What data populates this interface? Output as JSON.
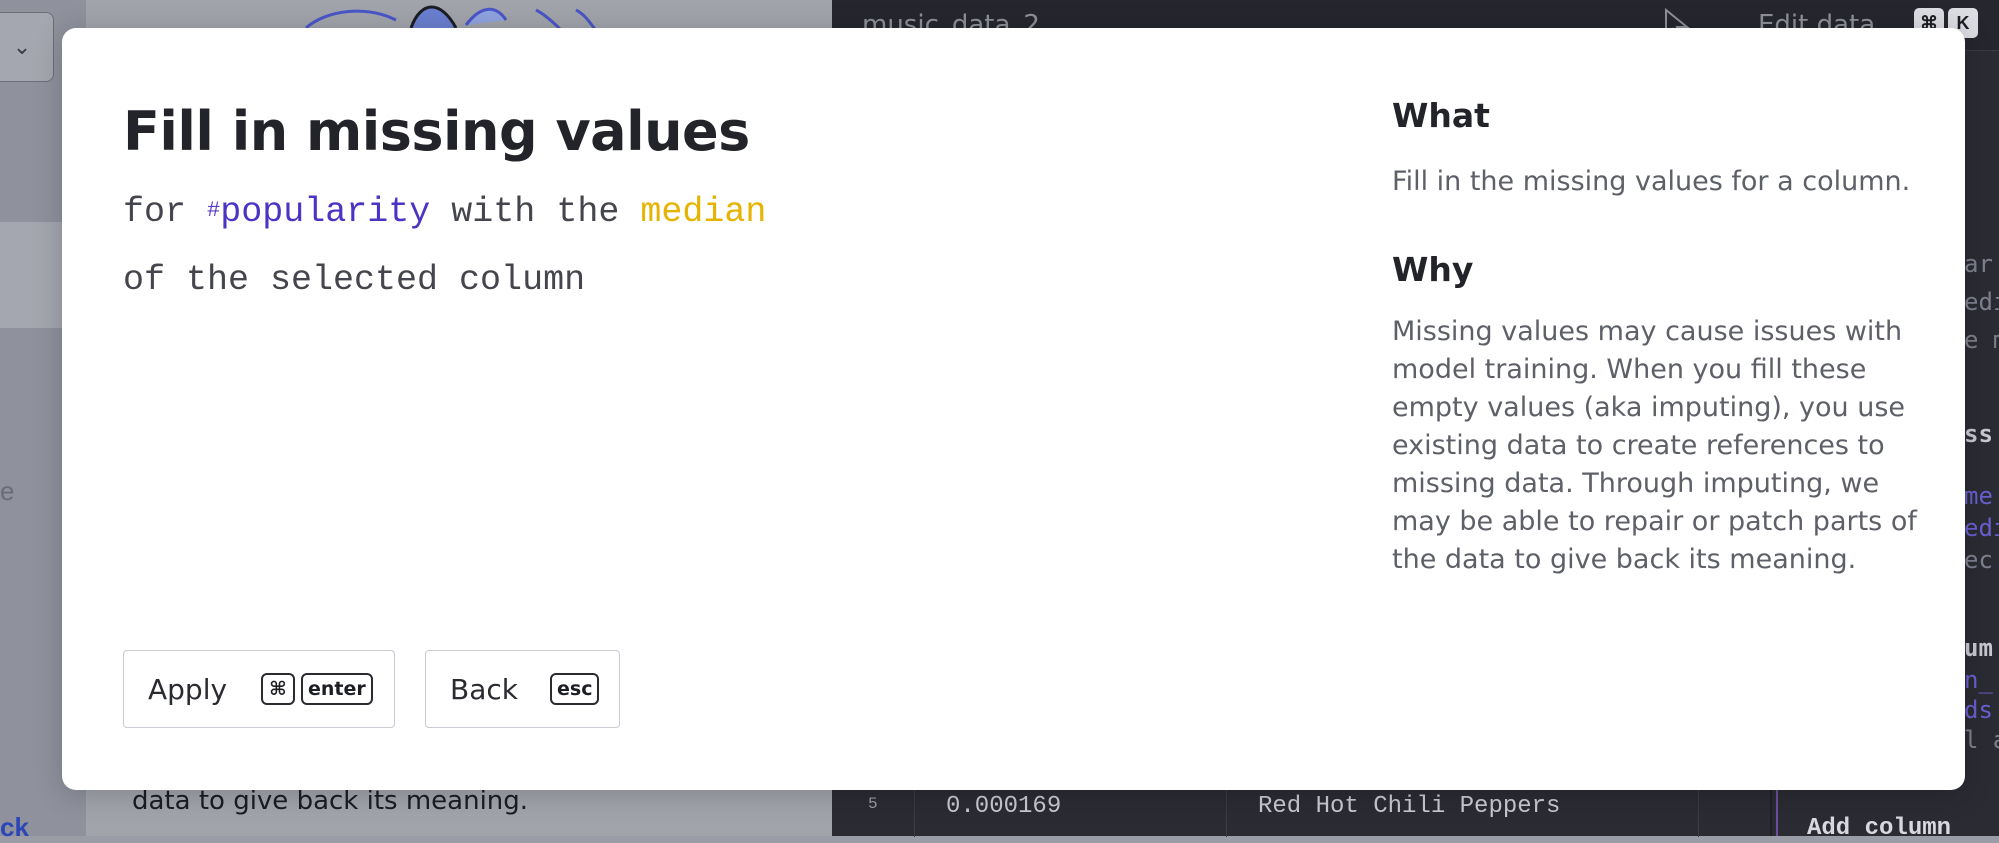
{
  "background": {
    "left_fragment_e": "e",
    "left_fragment_link": "ck",
    "mid_bottom_text": "data to give back its meaning.",
    "tab_title": "music_data_2",
    "edit_label": "Edit data",
    "shortcut_cmd": "⌘",
    "shortcut_k": "K",
    "right_fragments": [
      "ar",
      "edi",
      "e m",
      "ss",
      "me",
      "edi",
      "ec",
      "um",
      "n_",
      "ds",
      "l a"
    ],
    "table_row": {
      "index": "5",
      "value": "0.000169",
      "artist": "Red Hot Chili Peppers"
    },
    "add_column": "Add column"
  },
  "modal": {
    "title": "Fill in missing values",
    "action": {
      "prefix": "for",
      "column_type_icon": "#",
      "column": "popularity",
      "middle": "with the",
      "method": "median",
      "line2": "of the selected column"
    },
    "what": {
      "heading": "What",
      "text": "Fill in the missing values for a column."
    },
    "why": {
      "heading": "Why",
      "text": "Missing values may cause issues with model training. When you fill these empty values (aka imputing), you use existing data to create references to missing data. Through imputing, we may be able to repair or patch parts of the data to give back its meaning."
    },
    "buttons": {
      "apply_label": "Apply",
      "apply_key_cmd": "⌘",
      "apply_key_enter": "enter",
      "back_label": "Back",
      "back_key": "esc"
    }
  },
  "colors": {
    "column_name": "#4a34c4",
    "method": "#e6b400",
    "title": "#232429"
  }
}
